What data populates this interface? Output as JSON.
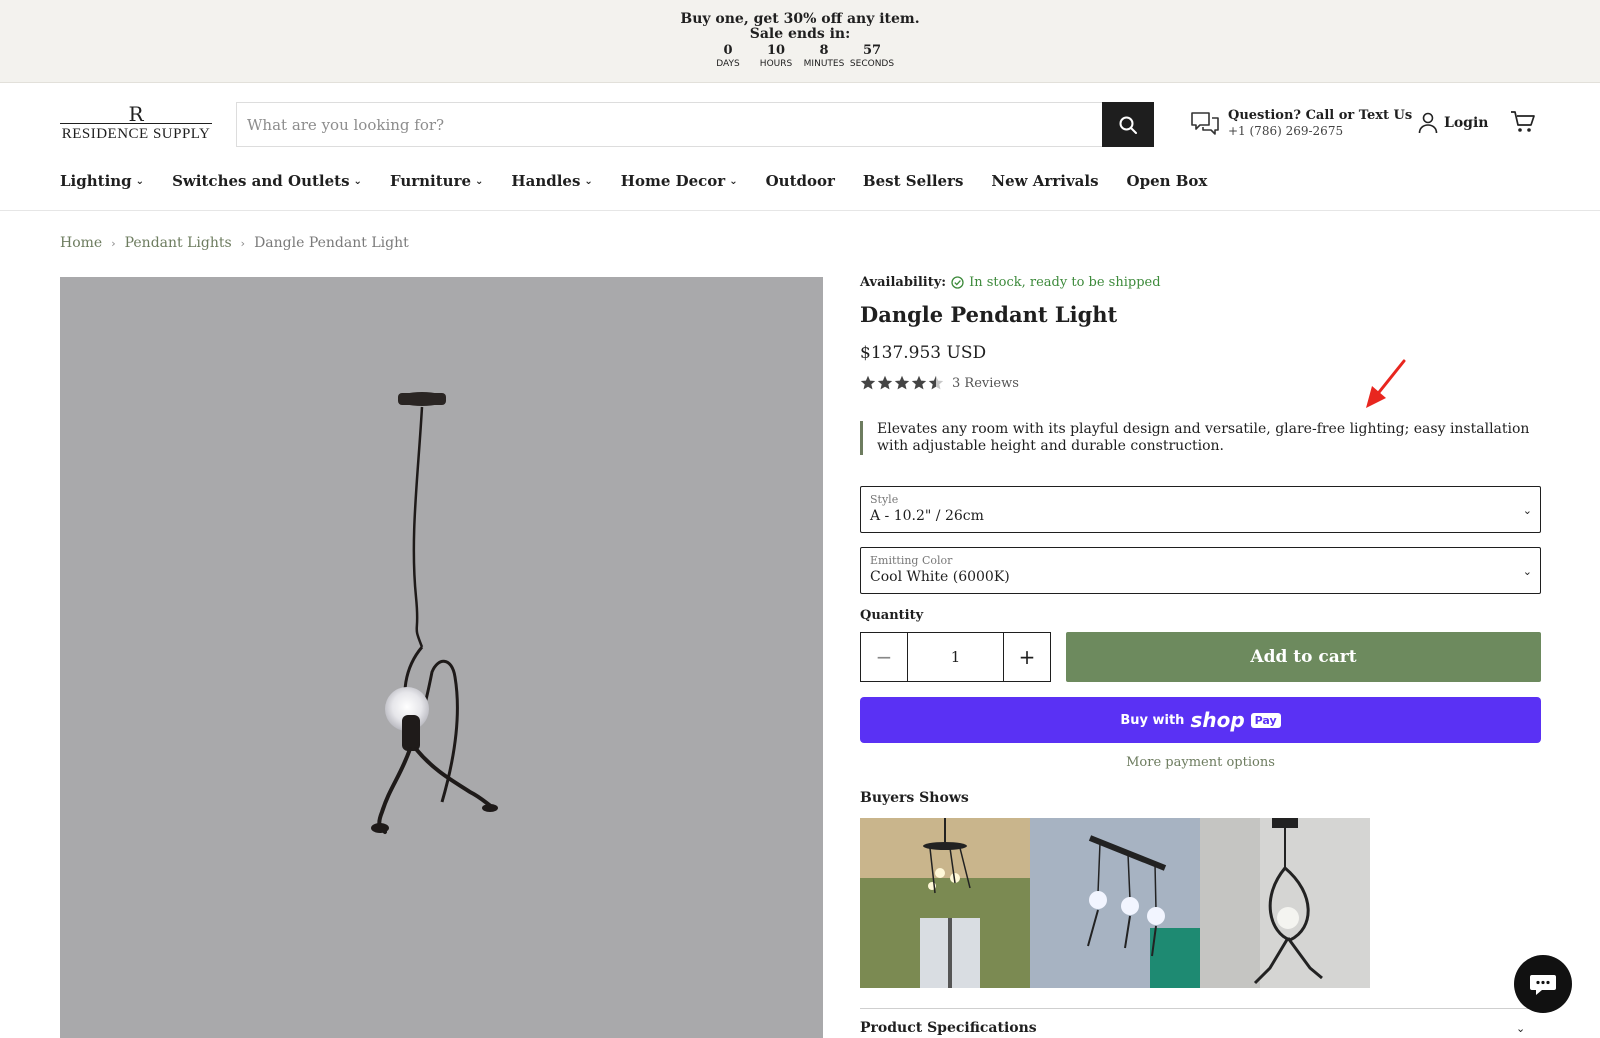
{
  "announcement": {
    "line1": "Buy one, get 30% off any item.",
    "line2": "Sale ends in:",
    "countdown": [
      {
        "value": "0",
        "label": "DAYS"
      },
      {
        "value": "10",
        "label": "HOURS"
      },
      {
        "value": "8",
        "label": "MINUTES"
      },
      {
        "value": "57",
        "label": "SECONDS"
      }
    ]
  },
  "header": {
    "logo_mark": "R",
    "logo_name": "RESIDENCE SUPPLY",
    "search_placeholder": "What are you looking for?",
    "contact_title": "Question? Call or Text Us",
    "contact_phone": "+1 (786) 269-2675",
    "login_label": "Login"
  },
  "nav": [
    {
      "label": "Lighting",
      "has_dropdown": true
    },
    {
      "label": "Switches and Outlets",
      "has_dropdown": true
    },
    {
      "label": "Furniture",
      "has_dropdown": true
    },
    {
      "label": "Handles",
      "has_dropdown": true
    },
    {
      "label": "Home Decor",
      "has_dropdown": true
    },
    {
      "label": "Outdoor",
      "has_dropdown": false
    },
    {
      "label": "Best Sellers",
      "has_dropdown": false
    },
    {
      "label": "New Arrivals",
      "has_dropdown": false
    },
    {
      "label": "Open Box",
      "has_dropdown": false
    }
  ],
  "breadcrumb": [
    "Home",
    "Pendant Lights",
    "Dangle Pendant Light"
  ],
  "product": {
    "availability_label": "Availability:",
    "availability_status": "In stock, ready to be shipped",
    "title": "Dangle Pendant Light",
    "price": "$137.953 USD",
    "rating": 4.5,
    "reviews": "3 Reviews",
    "description": "Elevates any room with its playful design and versatile, glare-free lighting; easy installation with adjustable height and durable construction.",
    "style_label": "Style",
    "style_value": "A - 10.2\" / 26cm",
    "color_label": "Emitting Color",
    "color_value": "Cool White (6000K)",
    "quantity_label": "Quantity",
    "quantity_value": "1",
    "add_to_cart": "Add to cart",
    "shop_pay_prefix": "Buy with",
    "shop_pay_brand": "shop",
    "shop_pay_badge": "Pay",
    "more_payment": "More payment options",
    "buyers_shows_title": "Buyers Shows",
    "spec_title": "Product Specifications"
  },
  "colors": {
    "accent_green": "#6d8a5e",
    "stock_green": "#3d8a3b",
    "shop_pay": "#5a31f4",
    "announcement_bg": "#f3f2ee"
  }
}
